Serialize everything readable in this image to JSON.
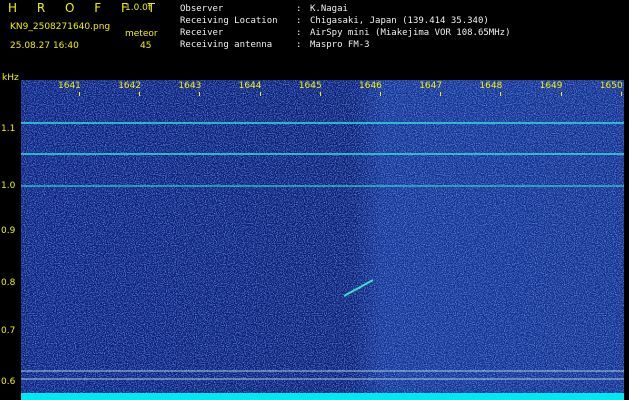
{
  "header": {
    "brand": "H R O F F T",
    "version": "1.0.0f",
    "filename": "KN9_2508271640.png",
    "mode_label": "meteor",
    "timestamp": "25.08.27 16:40",
    "count": "45"
  },
  "info": {
    "rows": [
      {
        "key": "Observer",
        "value": "K.Nagai"
      },
      {
        "key": "Receiving Location",
        "value": "Chigasaki, Japan (139.414 35.340)"
      },
      {
        "key": "Receiver",
        "value": "AirSpy mini (Miakejima VOR 108.65MHz)"
      },
      {
        "key": "Receiving antenna",
        "value": "Maspro FM-3"
      }
    ]
  },
  "axis": {
    "y_unit": "kHz",
    "y_ticks": [
      "1.1",
      "1.0",
      "0.9",
      "0.8",
      "0.7",
      "0.6"
    ],
    "x_ticks": [
      "1641",
      "1642",
      "1643",
      "1644",
      "1645",
      "1646",
      "1647",
      "1648",
      "1649",
      "1650"
    ]
  },
  "colors": {
    "label": "#f0f000",
    "text": "#f0f0f0",
    "background": "#0a1a6e",
    "noise": "#2a50d0",
    "carrier": "#30e8e0",
    "bottom_band": "#00e8f0"
  }
}
